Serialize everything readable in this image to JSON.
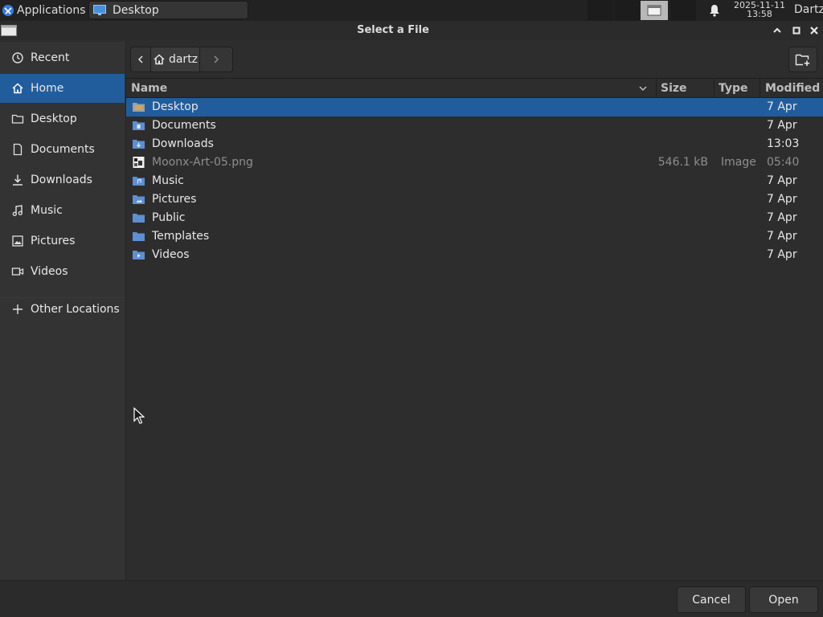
{
  "taskbar": {
    "applications_label": "Applications",
    "active_task_label": "Desktop",
    "clock_date": "2025-11-11",
    "clock_time": "13:58",
    "user_label": "Dartz"
  },
  "window": {
    "title": "Select a File"
  },
  "sidebar": {
    "items": [
      {
        "label": "Recent",
        "icon": "clock-icon"
      },
      {
        "label": "Home",
        "icon": "home-icon",
        "selected": true
      },
      {
        "label": "Desktop",
        "icon": "folder-icon"
      },
      {
        "label": "Documents",
        "icon": "document-icon"
      },
      {
        "label": "Downloads",
        "icon": "download-icon"
      },
      {
        "label": "Music",
        "icon": "music-icon"
      },
      {
        "label": "Pictures",
        "icon": "picture-icon"
      },
      {
        "label": "Videos",
        "icon": "video-icon"
      }
    ],
    "other_locations": "Other Locations"
  },
  "pathbar": {
    "current": "dartz"
  },
  "columns": {
    "name": "Name",
    "size": "Size",
    "type": "Type",
    "modified": "Modified"
  },
  "files": [
    {
      "name": "Desktop",
      "size": "",
      "type": "",
      "modified": "7 Apr",
      "kind": "folder",
      "selected": true
    },
    {
      "name": "Documents",
      "size": "",
      "type": "",
      "modified": "7 Apr",
      "kind": "folder"
    },
    {
      "name": "Downloads",
      "size": "",
      "type": "",
      "modified": "13:03",
      "kind": "folder"
    },
    {
      "name": "Moonx-Art-05.png",
      "size": "546.1 kB",
      "type": "Image",
      "modified": "05:40",
      "kind": "image"
    },
    {
      "name": "Music",
      "size": "",
      "type": "",
      "modified": "7 Apr",
      "kind": "folder"
    },
    {
      "name": "Pictures",
      "size": "",
      "type": "",
      "modified": "7 Apr",
      "kind": "folder"
    },
    {
      "name": "Public",
      "size": "",
      "type": "",
      "modified": "7 Apr",
      "kind": "folder"
    },
    {
      "name": "Templates",
      "size": "",
      "type": "",
      "modified": "7 Apr",
      "kind": "folder"
    },
    {
      "name": "Videos",
      "size": "",
      "type": "",
      "modified": "7 Apr",
      "kind": "folder"
    }
  ],
  "footer": {
    "cancel_label": "Cancel",
    "open_label": "Open"
  },
  "colors": {
    "accent": "#215d9c",
    "background": "#2d2d2d",
    "sidebar": "#333333"
  }
}
